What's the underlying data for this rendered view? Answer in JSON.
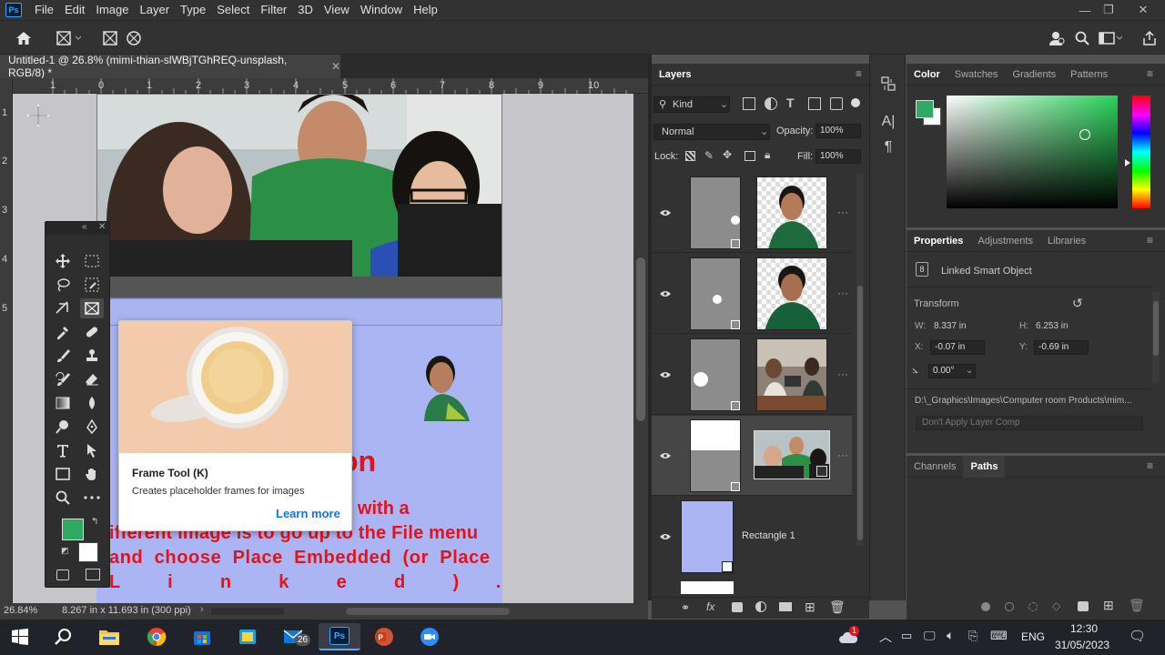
{
  "app": {
    "name": "Ps",
    "menus": [
      "File",
      "Edit",
      "Image",
      "Layer",
      "Type",
      "Select",
      "Filter",
      "3D",
      "View",
      "Window",
      "Help"
    ]
  },
  "document": {
    "tab_title": "Untitled-1 @ 26.8% (mimi-thian-slWBjTGhREQ-unsplash, RGB/8) *",
    "zoom": "26.84%",
    "doc_info": "8.267 in x 11.693 in (300 ppi)"
  },
  "ruler": {
    "h_labels": [
      "1",
      "0",
      "1",
      "2",
      "3",
      "4",
      "5",
      "6",
      "7",
      "8",
      "9",
      "10"
    ],
    "v_labels": [
      "1",
      "2",
      "3",
      "4",
      "5"
    ]
  },
  "canvas_text": {
    "line1": "on",
    "line2": "ent image with a",
    "line3": "ifferent image is to go up to the File menu",
    "line4": "and  choose  Place  Embedded  (or  Place",
    "line5": "L    i    n    k    e    d    )   ."
  },
  "tooltip": {
    "title": "Frame Tool (K)",
    "desc": "Creates placeholder frames for images",
    "link": "Learn more"
  },
  "layers": {
    "tab": "Layers",
    "filter": "Kind",
    "blend": "Normal",
    "opacity_label": "Opacity:",
    "opacity": "100%",
    "lock_label": "Lock:",
    "fill_label": "Fill:",
    "fill": "100%",
    "rows": [
      {
        "name": ""
      },
      {
        "name": ""
      },
      {
        "name": ""
      },
      {
        "name": ""
      },
      {
        "name": "Rectangle 1"
      }
    ]
  },
  "color": {
    "tabs": [
      "Color",
      "Swatches",
      "Gradients",
      "Patterns"
    ],
    "fg": "#2eaa62",
    "bg": "#ffffff",
    "hue": "#29d35a"
  },
  "properties": {
    "tabs": [
      "Properties",
      "Adjustments",
      "Libraries"
    ],
    "object_type": "Linked Smart Object",
    "transform_label": "Transform",
    "w_label": "W:",
    "w": "8.337 in",
    "h_label": "H:",
    "h": "6.253 in",
    "x_label": "X:",
    "x": "-0.07 in",
    "y_label": "Y:",
    "y": "-0.69 in",
    "angle": "0.00°",
    "path": "D:\\_Graphics\\Images\\Computer room Products\\mim...",
    "layer_comp": "Don't Apply Layer Comp"
  },
  "channels": {
    "tabs": [
      "Channels",
      "Paths"
    ]
  },
  "taskbar": {
    "time": "12:30",
    "date": "31/05/2023",
    "lang": "ENG",
    "mail_badge": "26",
    "notif_badge": "1"
  }
}
